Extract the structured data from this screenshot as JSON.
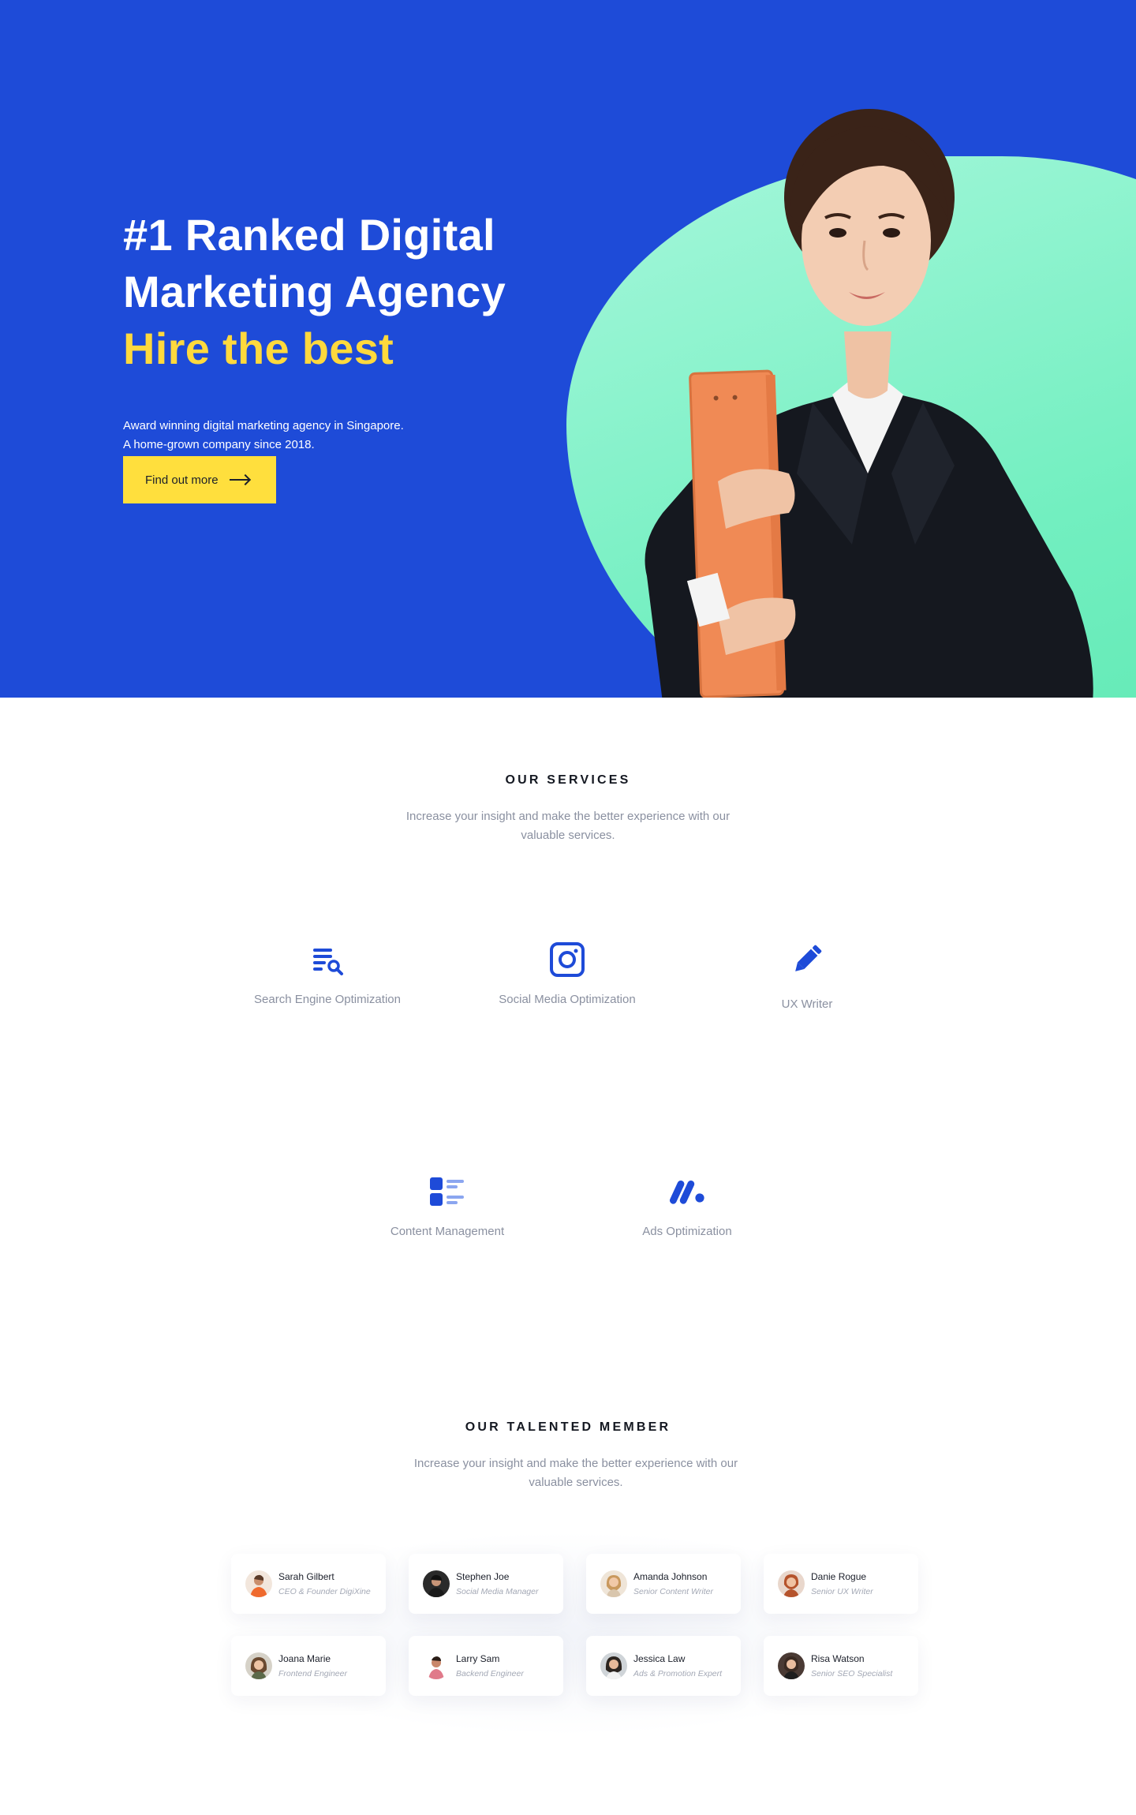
{
  "hero": {
    "title_line1": "#1 Ranked Digital",
    "title_line2": "Marketing Agency",
    "title_accent": "Hire the best",
    "subtitle_line1": "Award winning digital marketing agency in Singapore.",
    "subtitle_line2": "A home-grown company since 2018.",
    "cta_label": "Find out more",
    "colors": {
      "background": "#1e4bd8",
      "accent": "#ffd93d",
      "blob": "#7ff0c6",
      "button": "#ffdf3d"
    }
  },
  "services": {
    "title": "OUR SERVICES",
    "subtitle_line1": "Increase your insight and make the better experience with our",
    "subtitle_line2": "valuable services.",
    "items": [
      {
        "label": "Search Engine Optimization",
        "icon": "search-list-icon"
      },
      {
        "label": "Social Media Optimization",
        "icon": "instagram-icon"
      },
      {
        "label": "UX Writer",
        "icon": "pencil-icon"
      },
      {
        "label": "Content Management",
        "icon": "content-list-icon"
      },
      {
        "label": "Ads Optimization",
        "icon": "ads-m-icon"
      }
    ]
  },
  "members": {
    "title": "OUR TALENTED MEMBER",
    "subtitle_line1": "Increase your insight and make the better experience with our",
    "subtitle_line2": "valuable services.",
    "items": [
      {
        "name": "Sarah Gilbert",
        "role": "CEO & Founder DigiXine"
      },
      {
        "name": "Stephen Joe",
        "role": "Social Media Manager"
      },
      {
        "name": "Amanda Johnson",
        "role": "Senior Content Writer"
      },
      {
        "name": "Danie Rogue",
        "role": "Senior UX Writer"
      },
      {
        "name": "Joana Marie",
        "role": "Frontend Engineer"
      },
      {
        "name": "Larry Sam",
        "role": "Backend Engineer"
      },
      {
        "name": "Jessica Law",
        "role": "Ads & Promotion Expert"
      },
      {
        "name": "Risa Watson",
        "role": "Senior SEO Specialist"
      }
    ]
  }
}
